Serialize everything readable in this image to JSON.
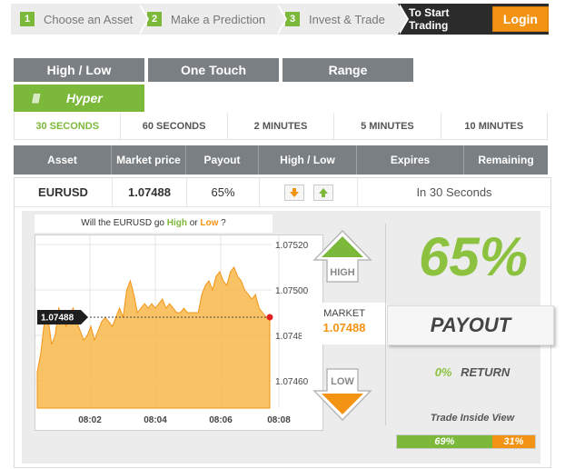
{
  "steps": [
    {
      "num": "1",
      "label": "Choose an Asset"
    },
    {
      "num": "2",
      "label": "Make a Prediction"
    },
    {
      "num": "3",
      "label": "Invest & Trade"
    }
  ],
  "cta": {
    "text": "To Start Trading",
    "login_label": "Login"
  },
  "trade_types": [
    "High / Low",
    "One Touch",
    "Range"
  ],
  "hyper_tab": {
    "bars": "////",
    "label": "Hyper"
  },
  "durations": [
    {
      "label": "30 SECONDS",
      "active": true
    },
    {
      "label": "60 SECONDS",
      "active": false
    },
    {
      "label": "2 MINUTES",
      "active": false
    },
    {
      "label": "5 MINUTES",
      "active": false
    },
    {
      "label": "10 MINUTES",
      "active": false
    }
  ],
  "table": {
    "headers": [
      "Asset",
      "Market price",
      "Payout",
      "High / Low",
      "Expires",
      "Remaining"
    ],
    "row": {
      "asset": "EURUSD",
      "price": "1.07488",
      "payout": "65%",
      "expires": "In 30 Seconds"
    }
  },
  "question": {
    "prefix": "Will the EURUSD go ",
    "high": "High",
    "mid": " or ",
    "low": "Low",
    "suffix": " ?"
  },
  "market": {
    "label": "MARKET",
    "value": "1.07488"
  },
  "buttons": {
    "high_label": "HIGH",
    "low_label": "LOW"
  },
  "payout": {
    "value": "65%",
    "label": "PAYOUT"
  },
  "return_info": {
    "pct": "0%",
    "label": "RETURN"
  },
  "trade_inside_view": {
    "label": "Trade Inside View",
    "high_pct": "69%",
    "low_pct": "31%",
    "high_share": 0.69
  },
  "colors": {
    "green": "#7cb83a",
    "orange": "#f39314",
    "gray": "#7a7f83",
    "dark": "#2b2b2b"
  },
  "chart_data": {
    "type": "area",
    "x_ticks": [
      "08:02",
      "08:04",
      "08:06",
      "08:08"
    ],
    "y_ticks": [
      "1.07520",
      "1.07500",
      "1.07480",
      "1.07460"
    ],
    "ylim": [
      1.07448,
      1.07524
    ],
    "current_price_label": "1.07488",
    "current_price": 1.07488,
    "x": [
      0,
      1,
      2,
      3,
      4,
      5,
      6,
      7,
      8,
      9,
      10,
      11,
      12,
      13,
      14,
      15,
      16,
      17,
      18,
      19,
      20,
      21,
      22,
      23,
      24,
      25,
      26,
      27,
      28,
      29,
      30,
      31,
      32,
      33,
      34,
      35,
      36,
      37,
      38,
      39,
      40,
      41,
      42,
      43,
      44,
      45,
      46,
      47,
      48,
      49,
      50,
      51,
      52,
      53,
      54,
      55,
      56,
      57,
      58,
      59,
      60,
      61,
      62,
      63,
      64,
      65
    ],
    "values": [
      1.07464,
      1.07472,
      1.07486,
      1.07488,
      1.07476,
      1.0748,
      1.07492,
      1.07488,
      1.07484,
      1.07488,
      1.07492,
      1.07486,
      1.07482,
      1.07478,
      1.0748,
      1.07484,
      1.07478,
      1.07482,
      1.07486,
      1.07488,
      1.07486,
      1.07484,
      1.07488,
      1.07492,
      1.07488,
      1.075,
      1.07504,
      1.07498,
      1.0749,
      1.07492,
      1.07494,
      1.07492,
      1.07494,
      1.07492,
      1.07494,
      1.07496,
      1.07492,
      1.07494,
      1.07492,
      1.0749,
      1.0749,
      1.07492,
      1.0749,
      1.0749,
      1.0749,
      1.0749,
      1.07498,
      1.07502,
      1.07504,
      1.075,
      1.07506,
      1.07508,
      1.07504,
      1.07502,
      1.07508,
      1.0751,
      1.07506,
      1.07504,
      1.075,
      1.07498,
      1.07496,
      1.07498,
      1.07492,
      1.0749,
      1.07488,
      1.07488
    ],
    "grid": true
  }
}
